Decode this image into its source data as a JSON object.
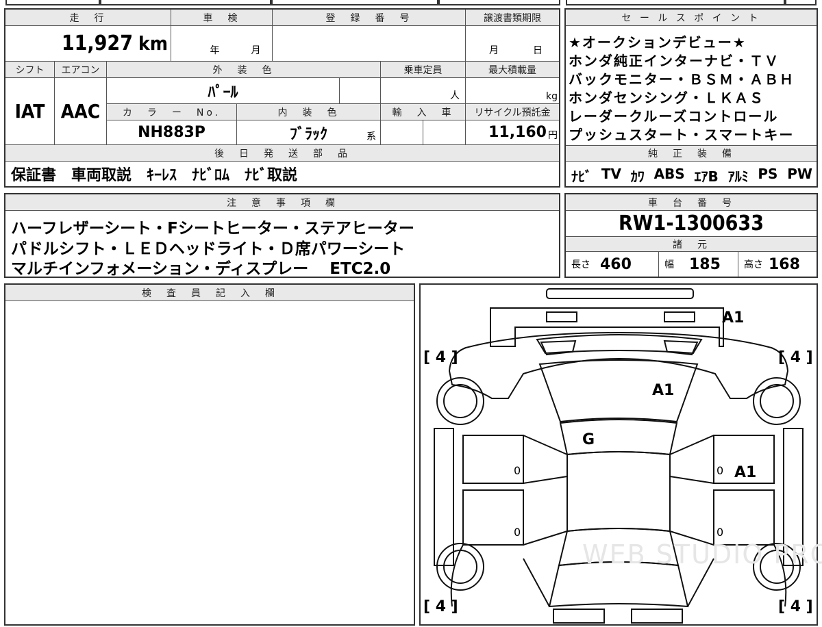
{
  "mileage": {
    "header": "走　行",
    "value": "11,927",
    "unit": "km"
  },
  "inspection": {
    "header": "車　検",
    "year_label": "年",
    "month_label": "月"
  },
  "registration": {
    "header": "登　録　番　号",
    "value": ""
  },
  "transfer_deadline": {
    "header": "譲渡書類期限",
    "month_label": "月",
    "day_label": "日"
  },
  "shift": {
    "header": "シフト",
    "value": "IAT"
  },
  "aircon": {
    "header": "エアコン",
    "value": "AAC"
  },
  "exterior_color": {
    "header": "外　装　色",
    "value": "ﾊﾟｰﾙ"
  },
  "capacity": {
    "header": "乗車定員",
    "unit": "人"
  },
  "max_load": {
    "header": "最大積載量",
    "unit": "kg"
  },
  "color_no": {
    "header": "カ　ラ　ー　No.",
    "value": "NH883P"
  },
  "interior_color": {
    "header": "内　装　色",
    "value": "ﾌﾞﾗｯｸ",
    "suffix": "系"
  },
  "import": {
    "header": "輸　入　車"
  },
  "recycle": {
    "header": "リサイクル預託金",
    "value": "11,160",
    "unit": "円"
  },
  "later_parts": {
    "header": "後　日　発　送　部　品",
    "value": "保証書　車両取説　ｷｰﾚｽ　ﾅﾋﾞﾛﾑ　ﾅﾋﾞ取説"
  },
  "sales_points": {
    "header": "セ ー ル ス ポ イ ン ト",
    "lines": [
      "★オークションデビュー★",
      "ホンダ純正インターナビ・ＴＶ",
      "バックモニター・ＢＳＭ・ＡＢＨ",
      "ホンダセンシング・ＬＫＡＳ",
      "レーダークルーズコントロール",
      "プッシュスタート・スマートキー"
    ]
  },
  "equipment": {
    "header": "純　正　装　備",
    "items": [
      "ﾅﾋﾞ",
      "TV",
      "ｶﾜ",
      "ABS",
      "ｴｱB",
      "ｱﾙﾐ",
      "PS",
      "PW"
    ]
  },
  "notes": {
    "header": "注　意　事　項　欄",
    "lines": [
      "ハーフレザーシート・Fシートヒーター・ステアヒーター",
      "パドルシフト・ＬＥＤヘッドライト・Ｄ席パワーシート",
      "マルチインフォメーション・ディスプレー　 ETC2.0"
    ]
  },
  "chassis": {
    "header": "車　台　番　号",
    "value": "RW1-1300633"
  },
  "dimensions": {
    "header": "諸　元",
    "length_label": "長さ",
    "length": "460",
    "width_label": "幅",
    "width": "185",
    "height_label": "高さ",
    "height": "168"
  },
  "inspector": {
    "header": "検　査　員　記　入　欄"
  },
  "diagram": {
    "label_front_bumper": "A1",
    "label_hood": "A1",
    "label_windshield": "G",
    "label_right_door": "A1",
    "tire_fl": "[ 4 ]",
    "tire_fr": "[ 4 ]",
    "tire_rl": "[ 4 ]",
    "tire_rr": "[ 4 ]",
    "zero": "0",
    "watermark": "WEB STUDIO PRO"
  }
}
